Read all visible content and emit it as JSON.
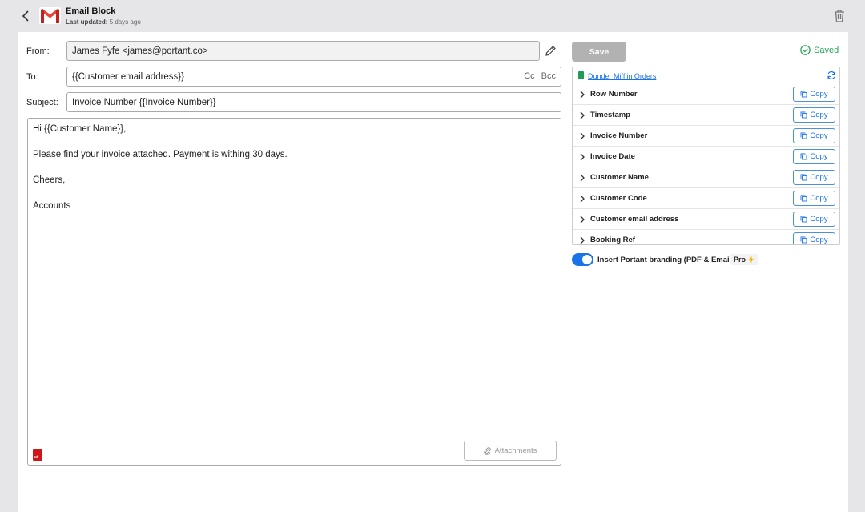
{
  "header": {
    "title": "Email Block",
    "last_updated_label": "Last updated:",
    "last_updated_value": "5 days ago"
  },
  "form": {
    "from_label": "From:",
    "from_value": "James Fyfe <james@portant.co>",
    "to_label": "To:",
    "to_value": "{{Customer email address}}",
    "cc_label": "Cc",
    "bcc_label": "Bcc",
    "subject_label": "Subject:",
    "subject_value": "Invoice Number {{Invoice Number}}",
    "body_lines": [
      "Hi {{Customer Name}},",
      "Please find your invoice attached. Payment is withing 30 days.",
      "Cheers,",
      "Accounts"
    ],
    "pdf_icon_text": "pdf",
    "attachments_label": "Attachments"
  },
  "actions": {
    "save_label": "Save",
    "saved_label": "Saved"
  },
  "sheet": {
    "name": "Dunder Mifflin Orders",
    "copy_label": "Copy",
    "variables": [
      "Row Number",
      "Timestamp",
      "Invoice Number",
      "Invoice Date",
      "Customer Name",
      "Customer Code",
      "Customer email address",
      "Booking Ref"
    ]
  },
  "branding": {
    "toggle_on": true,
    "label": "Insert Portant branding (PDF & Email)",
    "badge": "Pro"
  },
  "colors": {
    "accent": "#1a73e8",
    "saved_green": "#24a65a",
    "save_disabled": "#b2b2b2",
    "gmail_red": "#ea4335",
    "sheets_green": "#1f9d55"
  }
}
